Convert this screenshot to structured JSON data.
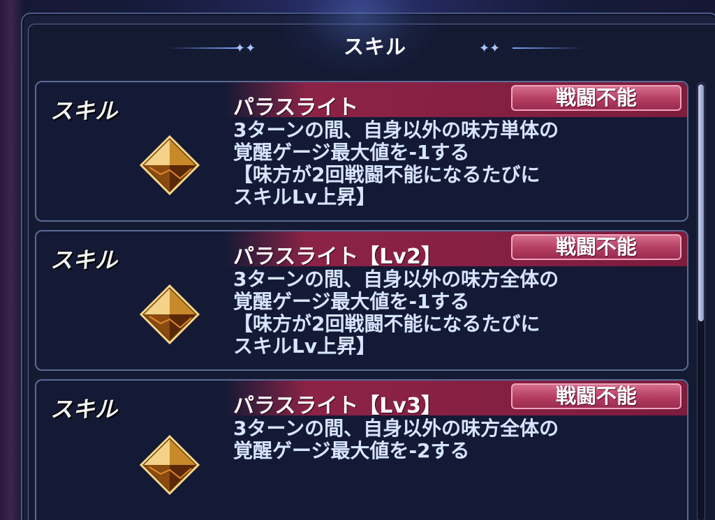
{
  "header": {
    "title": "スキル"
  },
  "skills": [
    {
      "label": "スキル",
      "name": "パラスライト",
      "tag": "戦闘不能",
      "description": "3ターンの間、自身以外の味方単体の\n覚醒ゲージ最大値を-1する\n【味方が2回戦闘不能になるたびに\nスキルLv上昇】",
      "icon": "gold-diamond-gem-icon"
    },
    {
      "label": "スキル",
      "name": "パラスライト【Lv2】",
      "tag": "戦闘不能",
      "description": "3ターンの間、自身以外の味方全体の\n覚醒ゲージ最大値を-1する\n【味方が2回戦闘不能になるたびに\nスキルLv上昇】",
      "icon": "gold-diamond-gem-icon"
    },
    {
      "label": "スキル",
      "name": "パラスライト【Lv3】",
      "tag": "戦闘不能",
      "description": "3ターンの間、自身以外の味方全体の\n覚醒ゲージ最大値を-2する",
      "icon": "gold-diamond-gem-icon"
    }
  ],
  "colors": {
    "name_band": "#8c2347",
    "tag_fill": "#b43d62",
    "description_text": "#d7e5ff",
    "card_border": "#5b6b96"
  }
}
